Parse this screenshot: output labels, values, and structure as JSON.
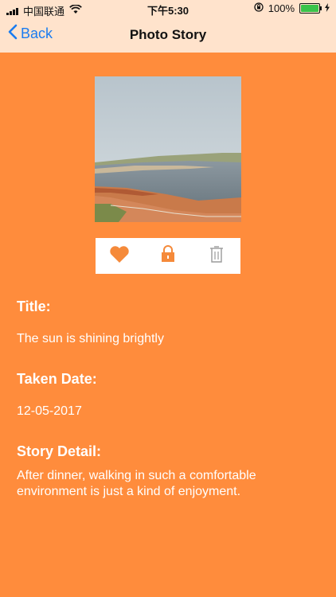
{
  "status_bar": {
    "carrier": "中国联通",
    "time": "下午5:30",
    "battery": "100%"
  },
  "nav": {
    "back_label": "Back",
    "title": "Photo Story"
  },
  "actions": {
    "favorite_icon": "heart-icon",
    "lock_icon": "lock-icon",
    "delete_icon": "trash-icon"
  },
  "story": {
    "title_label": "Title:",
    "title_value": "The sun is shining brightly",
    "date_label": "Taken Date:",
    "date_value": "12-05-2017",
    "detail_label": "Story Detail:",
    "detail_value": "After dinner, walking in such a comfortable environment is just a kind of enjoyment."
  },
  "colors": {
    "background": "#ff8c3c",
    "nav_background": "#ffe3cc",
    "accent": "#1a7cf0",
    "icon_orange": "#f58a3a"
  }
}
